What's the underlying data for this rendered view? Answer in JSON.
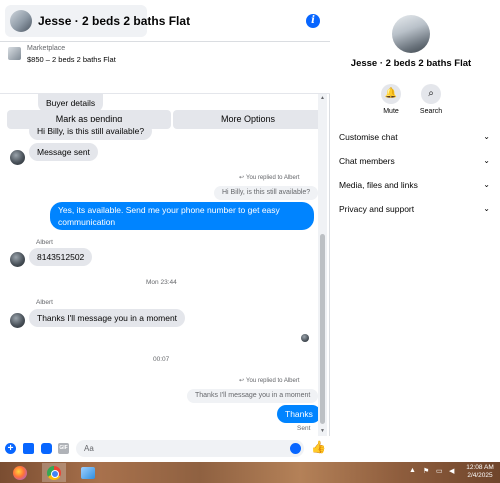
{
  "header": {
    "title": "Jesse · 2 beds 2 baths Flat",
    "info_icon": "info-icon",
    "accent": "#0866ff"
  },
  "listing": {
    "label": "Marketplace",
    "price_title": "$850 – 2 beds 2 baths Flat",
    "mark_pending": "Mark as pending",
    "more_options": "More Options"
  },
  "messages": {
    "buyer_details": "Buyer details",
    "m1": "Hi Billy, is this still available?",
    "m2": "Message sent",
    "reply1_tag": "You replied to Albert",
    "reply1_quote": "Hi Billy, is this still available?",
    "m3_line1": "Yes, its available. Send me your phone number to get easy",
    "m3_line2": "communication",
    "sender1": "Albert",
    "m4": "8143512502",
    "time1": "Mon 23:44",
    "sender2": "Albert",
    "m5": "Thanks I'll message you in a moment",
    "time2": "00:07",
    "reply2_tag": "You replied to Albert",
    "reply2_quote": "Thanks I'll message you in a moment",
    "m6": "Thanks",
    "status": "Sent",
    "bubble_out_color": "#0084ff",
    "bubble_in_color": "#e4e6eb"
  },
  "composer": {
    "placeholder": "Aa"
  },
  "panel": {
    "title": "Jesse · 2 beds 2 baths Flat",
    "actions": [
      {
        "label": "Mute",
        "icon": "bell-icon"
      },
      {
        "label": "Search",
        "icon": "search-icon"
      }
    ],
    "sections": [
      {
        "label": "Customise chat"
      },
      {
        "label": "Chat members"
      },
      {
        "label": "Media, files and links"
      },
      {
        "label": "Privacy and support"
      }
    ]
  },
  "taskbar": {
    "time": "12:08 AM",
    "date": "2/4/2025"
  }
}
